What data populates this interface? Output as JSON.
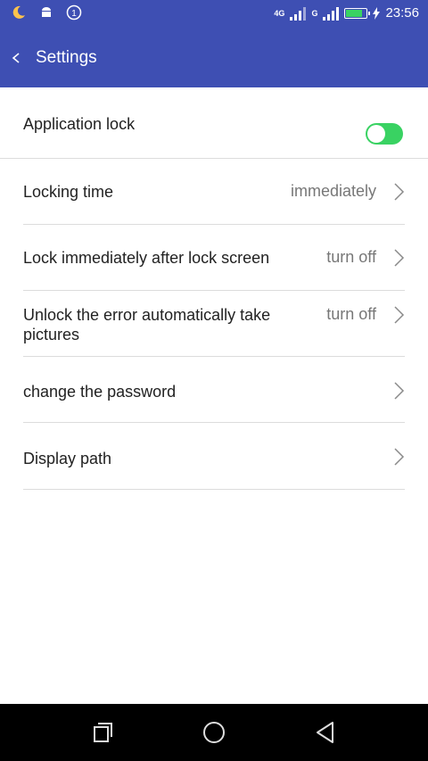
{
  "status_bar": {
    "network_a": "4G",
    "network_b": "G",
    "time": "23:56",
    "notification_icons": [
      "moon-icon",
      "android-icon",
      "info-circle-icon"
    ],
    "battery_level_fraction": 0.85
  },
  "app_bar": {
    "title": "Settings"
  },
  "settings": {
    "app_lock": {
      "label": "Application lock",
      "enabled": true
    },
    "items": [
      {
        "label": "Locking time",
        "value": "immediately"
      },
      {
        "label": "Lock immediately after lock screen",
        "value": "turn off"
      },
      {
        "label": "Unlock the error automatically take",
        "label2": "pictures",
        "value": "turn off"
      },
      {
        "label": "change the password",
        "value": ""
      },
      {
        "label": "Display path",
        "value": ""
      }
    ]
  },
  "colors": {
    "primary": "#3e4fb3",
    "toggle_on": "#39d262",
    "divider": "#dcdcdc"
  }
}
